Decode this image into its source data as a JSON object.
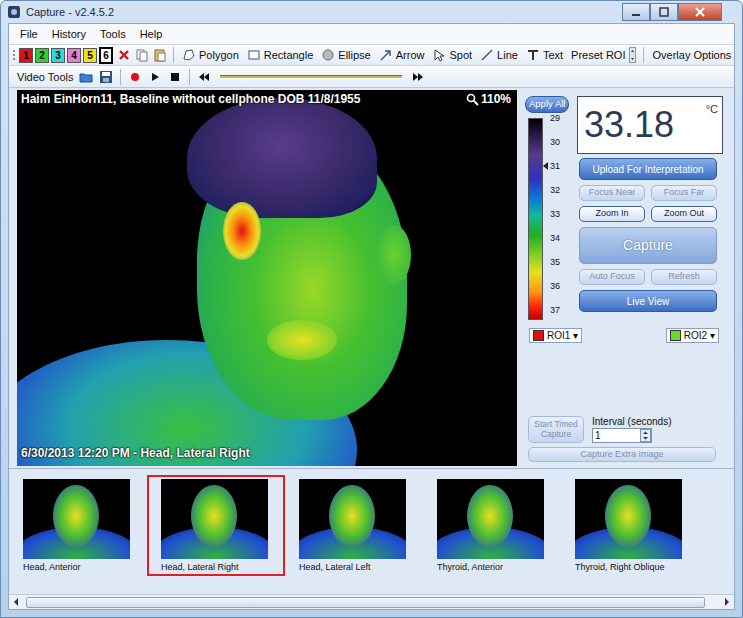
{
  "window": {
    "title": "Capture - v2.4.5.2"
  },
  "menu": [
    {
      "label": "File"
    },
    {
      "label": "History"
    },
    {
      "label": "Tools"
    },
    {
      "label": "Help"
    }
  ],
  "toolbar": {
    "roi_colors": [
      {
        "label": "1",
        "color": "#e01010",
        "selected": false
      },
      {
        "label": "2",
        "color": "#30d030",
        "selected": false
      },
      {
        "label": "3",
        "color": "#30d8d8",
        "selected": false
      },
      {
        "label": "4",
        "color": "#e080d8",
        "selected": false
      },
      {
        "label": "5",
        "color": "#f0e020",
        "selected": false
      },
      {
        "label": "6",
        "color": "#ffffff",
        "selected": true
      }
    ],
    "tools": [
      {
        "label": "Polygon"
      },
      {
        "label": "Rectangle"
      },
      {
        "label": "Ellipse"
      },
      {
        "label": "Arrow"
      },
      {
        "label": "Spot"
      },
      {
        "label": "Line"
      },
      {
        "label": "Text"
      },
      {
        "label": "Preset ROI"
      }
    ],
    "overlay": "Overlay Options"
  },
  "video_toolbar": {
    "label": "Video Tools"
  },
  "viewer": {
    "caption": "Haim EinHorn11, Baseline without cellphone DOB 11/8/1955",
    "zoom": "110%",
    "timestamp": "6/30/2013 12:20 PM - Head, Lateral Right"
  },
  "scale": {
    "apply_all": "Apply All",
    "ticks": [
      "29",
      "30",
      "31",
      "32",
      "33",
      "34",
      "35",
      "36",
      "37"
    ],
    "marker_level": 0.25
  },
  "reading": {
    "value": "33.18",
    "unit": "°C"
  },
  "controls": [
    [
      {
        "label": "Upload For Interpretation",
        "disabled": false,
        "kind": "wide"
      }
    ],
    [
      {
        "label": "Focus Near",
        "disabled": true,
        "kind": "small"
      },
      {
        "label": "Focus Far",
        "disabled": true,
        "kind": "small"
      }
    ],
    [
      {
        "label": "Zoom In",
        "disabled": false,
        "kind": "small"
      },
      {
        "label": "Zoom Out",
        "disabled": false,
        "kind": "small"
      }
    ],
    [
      {
        "label": "Capture",
        "disabled": true,
        "kind": "large"
      }
    ],
    [
      {
        "label": "Auto Focus",
        "disabled": true,
        "kind": "small"
      },
      {
        "label": "Refresh",
        "disabled": true,
        "kind": "small"
      }
    ],
    [
      {
        "label": "Live View",
        "disabled": false,
        "kind": "wide"
      }
    ]
  ],
  "roi": [
    {
      "label": "ROI1",
      "color": "#e01010",
      "arrow": "▾"
    },
    {
      "label": "ROI2",
      "color": "#66dd22",
      "arrow": "▾"
    }
  ],
  "timed": {
    "start": {
      "label": "Start Timed Capture",
      "disabled": true
    },
    "interval_label": "Interval (seconds)",
    "interval": "1",
    "extra": {
      "label": "Capture Extra Image",
      "disabled": true
    }
  },
  "thumbnails": [
    {
      "label": "Head, Anterior",
      "selected": false
    },
    {
      "label": "Head, Lateral Right",
      "selected": true
    },
    {
      "label": "Head, Lateral Left",
      "selected": false
    },
    {
      "label": "Thyroid, Anterior",
      "selected": false
    },
    {
      "label": "Thyroid, Right Oblique",
      "selected": false
    }
  ]
}
